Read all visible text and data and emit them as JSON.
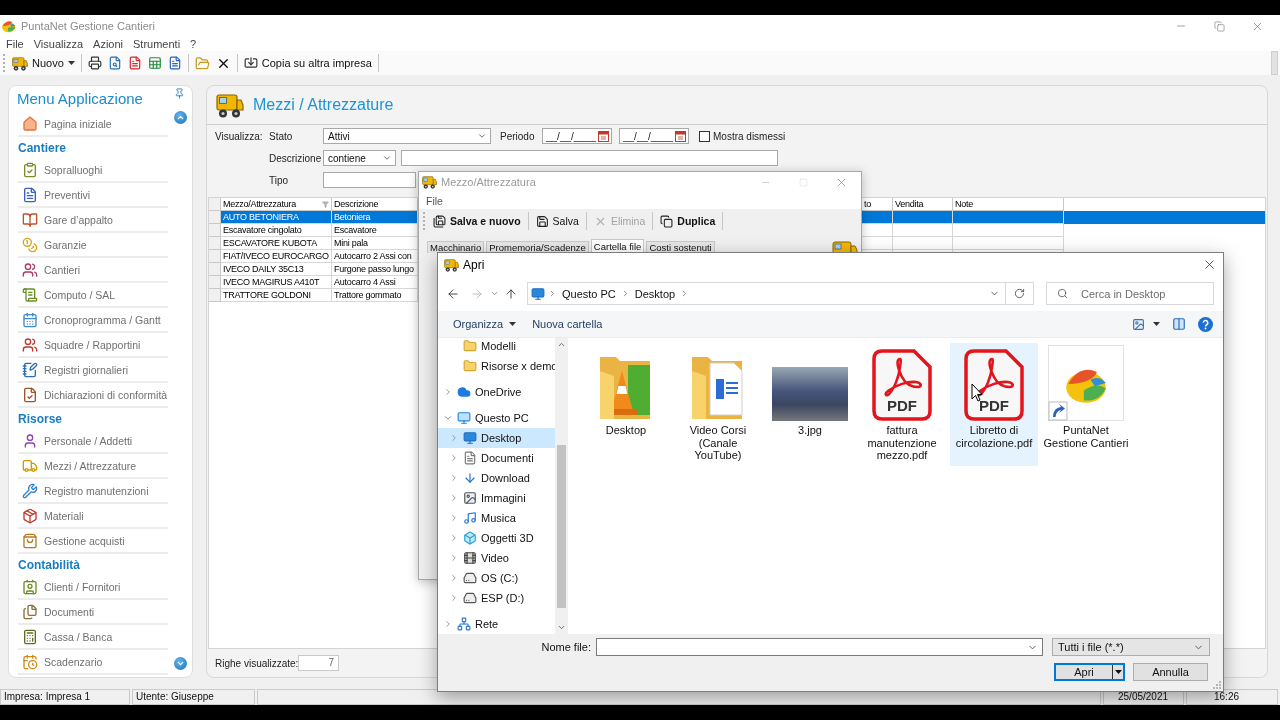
{
  "window": {
    "title": "PuntaNet Gestione Cantieri"
  },
  "menu_bar": [
    "File",
    "Visualizza",
    "Azioni",
    "Strumenti",
    "?"
  ],
  "toolbar": {
    "new_label": "Nuovo",
    "copy_label": "Copia su altra impresa"
  },
  "sidebar": {
    "title": "Menu Applicazione",
    "home": "Pagina iniziale",
    "sections": [
      {
        "title": "Cantiere",
        "items": [
          "Sopralluoghi",
          "Preventivi",
          "Gare d’appalto",
          "Garanzie",
          "Cantieri",
          "Computo / SAL",
          "Cronoprogramma / Gantt",
          "Squadre / Rapportini",
          "Registri giornalieri",
          "Dichiarazioni di conformità"
        ]
      },
      {
        "title": "Risorse",
        "items": [
          "Personale / Addetti",
          "Mezzi / Attrezzature",
          "Registro manutenzioni",
          "Materiali",
          "Gestione acquisti"
        ]
      },
      {
        "title": "Contabilità",
        "items": [
          "Clienti / Fornitori",
          "Documenti",
          "Cassa / Banca",
          "Scadenzario"
        ]
      }
    ]
  },
  "page": {
    "title": "Mezzi / Attrezzature",
    "filters": {
      "label": "Visualizza:",
      "stato": {
        "label": "Stato",
        "value": "Attivi"
      },
      "periodo": {
        "label": "Periodo",
        "from": {
          "placeholder": "__/__/____"
        },
        "to": {
          "placeholder": "__/__/____"
        }
      },
      "mostra_dismessi": {
        "label": "Mostra dismessi",
        "checked": false
      },
      "descrizione": {
        "label": "Descrizione",
        "operator": "contiene"
      },
      "tipo": {
        "label": "Tipo"
      }
    },
    "table": {
      "columns": [
        "Mezzo/Attrezzatura",
        "Descrizione",
        "to",
        "Vendita",
        "Note"
      ],
      "rows": [
        {
          "cells": [
            "AUTO BETONIERA",
            "Betoniera"
          ],
          "selected": true
        },
        {
          "cells": [
            "Escavatore cingolato",
            "Escavatore"
          ],
          "selected": false
        },
        {
          "cells": [
            "ESCAVATORE KUBOTA",
            "Mini pala"
          ],
          "selected": false
        },
        {
          "cells": [
            "FIAT/IVECO EUROCARGO",
            "Autocarro 2 Assi con"
          ],
          "selected": false
        },
        {
          "cells": [
            "IVECO DAILY 35C13",
            "Furgone passo lungo"
          ],
          "selected": false
        },
        {
          "cells": [
            "IVECO MAGIRUS A410T",
            "Autocarro 4 Assi"
          ],
          "selected": false
        },
        {
          "cells": [
            "TRATTORE GOLDONI",
            "Trattore gommato"
          ],
          "selected": false
        }
      ]
    },
    "footer": {
      "label": "Righe visualizzate:",
      "value": "7"
    }
  },
  "record_dialog": {
    "title": "Mezzo/Attrezzatura",
    "menu": [
      "File"
    ],
    "toolbar": [
      {
        "label": "Salva e nuovo",
        "kind": "strong",
        "disabled": false
      },
      {
        "label": "Salva",
        "kind": "plain",
        "disabled": false
      },
      {
        "label": "Elimina",
        "kind": "plain",
        "disabled": true
      },
      {
        "label": "Duplica",
        "kind": "strong",
        "disabled": false
      }
    ],
    "tabs": [
      {
        "label": "Macchinario",
        "selected": false
      },
      {
        "label": "Promemoria/Scadenze",
        "selected": false
      },
      {
        "label": "Cartella file",
        "selected": true
      },
      {
        "label": "Costi sostenuti",
        "selected": false
      }
    ]
  },
  "open_dialog": {
    "title": "Apri",
    "breadcrumb": [
      "Questo PC",
      "Desktop"
    ],
    "search": {
      "placeholder": "Cerca in Desktop"
    },
    "commands": [
      {
        "label": "Organizza",
        "menu": true
      },
      {
        "label": "Nuova cartella",
        "menu": false
      }
    ],
    "nav_tree": [
      {
        "children": [
          {
            "label": "Modelli",
            "selected": false
          },
          {
            "label": "Risorse x demo",
            "selected": false
          }
        ]
      },
      {
        "label": "OneDrive",
        "expanded": false,
        "selected": false
      },
      {
        "label": "Questo PC",
        "expanded": true,
        "selected": false,
        "children": [
          {
            "label": "Desktop",
            "expanded": false,
            "selected": true
          },
          {
            "label": "Documenti",
            "expanded": false,
            "selected": false
          },
          {
            "label": "Download",
            "expanded": false,
            "selected": false
          },
          {
            "label": "Immagini",
            "expanded": false,
            "selected": false
          },
          {
            "label": "Musica",
            "expanded": false,
            "selected": false
          },
          {
            "label": "Oggetti 3D",
            "expanded": false,
            "selected": false
          },
          {
            "label": "Video",
            "expanded": false,
            "selected": false
          },
          {
            "label": "OS (C:)",
            "expanded": false,
            "selected": false
          },
          {
            "label": "ESP (D:)",
            "expanded": false,
            "selected": false
          }
        ]
      },
      {
        "label": "Rete",
        "expanded": false,
        "selected": false
      }
    ],
    "files": [
      {
        "name": "Desktop",
        "kind": "folder",
        "selected": false
      },
      {
        "name": "Video Corsi (Canale YouTube)",
        "kind": "folder",
        "selected": false
      },
      {
        "name": "3.jpg",
        "kind": "image",
        "selected": false
      },
      {
        "name": "fattura manutenzione mezzo.pdf",
        "kind": "pdf",
        "icon_label": "PDF",
        "selected": false
      },
      {
        "name": "Libretto di circolazione.pdf",
        "kind": "pdf",
        "icon_label": "PDF",
        "selected": true
      },
      {
        "name": "PuntaNet Gestione Cantieri",
        "kind": "shortcut",
        "selected": false
      }
    ],
    "filename": {
      "label": "Nome file:"
    },
    "file_type": {
      "value": "Tutti i file (*.*)"
    },
    "buttons": [
      {
        "label": "Apri",
        "kind": "split"
      },
      {
        "label": "Annulla",
        "kind": "plain"
      }
    ]
  },
  "status_bar": {
    "left": [
      "Impresa: Impresa 1",
      "Utente: Giuseppe"
    ],
    "right": [
      "25/05/2021",
      "16:26"
    ]
  }
}
